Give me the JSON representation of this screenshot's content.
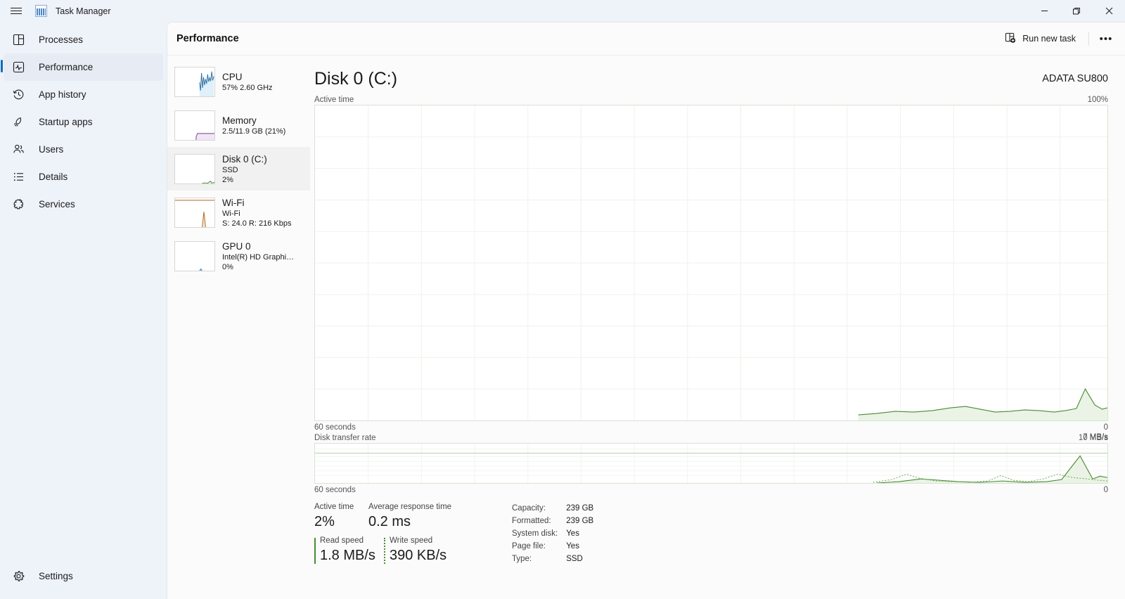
{
  "window": {
    "app_title": "Task Manager",
    "app_icon": "task-manager-icon",
    "menu_icon": "hamburger-icon",
    "minimize": "minimize-icon",
    "maximize": "maximize-icon",
    "close": "close-icon"
  },
  "sidebar": {
    "items": [
      {
        "label": "Processes",
        "icon": "processes-icon",
        "active": false
      },
      {
        "label": "Performance",
        "icon": "performance-icon",
        "active": true
      },
      {
        "label": "App history",
        "icon": "history-icon",
        "active": false
      },
      {
        "label": "Startup apps",
        "icon": "rocket-icon",
        "active": false
      },
      {
        "label": "Users",
        "icon": "users-icon",
        "active": false
      },
      {
        "label": "Details",
        "icon": "list-icon",
        "active": false
      },
      {
        "label": "Services",
        "icon": "services-icon",
        "active": false
      }
    ],
    "settings": {
      "label": "Settings",
      "icon": "gear-icon"
    }
  },
  "header": {
    "title": "Performance",
    "run_new_task": "Run new task",
    "run_new_task_icon": "new-task-icon",
    "more_options": "•••"
  },
  "devices": [
    {
      "name": "CPU",
      "lines": [
        "57%  2.60 GHz"
      ],
      "selected": false,
      "color": "#2e6fa3"
    },
    {
      "name": "Memory",
      "lines": [
        "2.5/11.9 GB (21%)"
      ],
      "selected": false,
      "color": "#7a3d92"
    },
    {
      "name": "Disk 0 (C:)",
      "lines": [
        "SSD",
        "2%"
      ],
      "selected": true,
      "color": "#4a8a35"
    },
    {
      "name": "Wi-Fi",
      "lines": [
        "Wi-Fi",
        "S: 24.0 R: 216 Kbps"
      ],
      "selected": false,
      "color": "#b5651d"
    },
    {
      "name": "GPU 0",
      "lines": [
        "Intel(R) HD Graphi…",
        "0%"
      ],
      "selected": false,
      "color": "#2e6fa3"
    }
  ],
  "detail": {
    "title": "Disk 0 (C:)",
    "model": "ADATA SU800",
    "active_time_label": "Active time",
    "active_time_max": "100%",
    "active_time_min": "0",
    "duration_top": "60 seconds",
    "duration_bottom": "60 seconds",
    "transfer_label": "Disk transfer rate",
    "transfer_max": "10 MB/s",
    "transfer_threshold": "7 MB/s",
    "transfer_min": "0"
  },
  "stats": {
    "active_time": {
      "label": "Active time",
      "value": "2%"
    },
    "average_response_time": {
      "label": "Average response time",
      "value": "0.2 ms"
    },
    "read_speed": {
      "label": "Read speed",
      "value": "1.8 MB/s"
    },
    "write_speed": {
      "label": "Write speed",
      "value": "390 KB/s"
    },
    "specs": [
      {
        "key": "Capacity:",
        "value": "239 GB"
      },
      {
        "key": "Formatted:",
        "value": "239 GB"
      },
      {
        "key": "System disk:",
        "value": "Yes"
      },
      {
        "key": "Page file:",
        "value": "Yes"
      },
      {
        "key": "Type:",
        "value": "SSD"
      }
    ]
  },
  "colors": {
    "accent": "#0f6cbd",
    "disk_line": "#4a8a35",
    "disk_fill": "#eaf3e5",
    "grid": "#eef3ec",
    "plot_border": "#d7e4d2"
  },
  "chart_data": [
    {
      "type": "area",
      "title": "Active time",
      "ylabel": "Active time (%)",
      "xlabel": "60 seconds",
      "ylim": [
        0,
        100
      ],
      "grid": true,
      "series": [
        {
          "name": "Active time",
          "values": [
            0,
            0,
            0,
            0,
            0,
            0,
            0,
            0,
            0,
            0,
            0,
            0,
            0,
            0,
            0,
            0,
            0,
            0,
            0,
            0,
            0,
            0,
            0,
            0,
            0,
            0,
            0,
            0,
            0,
            0,
            0,
            0,
            0,
            0,
            0,
            0,
            0,
            0,
            0,
            0,
            0,
            0,
            0,
            0,
            2,
            3,
            3,
            3,
            4,
            5,
            6,
            5,
            3,
            2,
            2,
            3,
            2,
            2,
            3,
            3,
            2,
            2,
            3,
            4,
            3,
            2,
            3,
            9,
            5,
            2
          ]
        }
      ]
    },
    {
      "type": "line",
      "title": "Disk transfer rate",
      "ylabel": "MB/s",
      "xlabel": "60 seconds",
      "ylim": [
        0,
        10
      ],
      "threshold": 7,
      "grid": true,
      "series": [
        {
          "name": "Read speed",
          "style": "solid",
          "values": [
            0,
            0,
            0,
            0,
            0,
            0,
            0,
            0,
            0,
            0,
            0,
            0,
            0,
            0,
            0,
            0,
            0,
            0,
            0,
            0,
            0,
            0,
            0,
            0,
            0,
            0,
            0,
            0,
            0,
            0,
            0,
            0,
            0,
            0,
            0,
            0,
            0,
            0,
            0,
            0,
            0,
            0,
            0.1,
            0.2,
            0.3,
            0.5,
            0.8,
            1.0,
            0.8,
            0.5,
            0.3,
            0.2,
            0.2,
            0.3,
            0.4,
            0.5,
            0.6,
            0.5,
            0.4,
            0.6,
            1.0,
            3.0,
            5.8,
            2.5,
            0.8,
            1.5,
            1.8,
            2.0,
            1.2,
            0.6
          ]
        },
        {
          "name": "Write speed",
          "style": "dotted",
          "values": [
            0,
            0,
            0,
            0,
            0,
            0,
            0,
            0,
            0,
            0,
            0,
            0,
            0,
            0,
            0,
            0,
            0,
            0,
            0,
            0,
            0,
            0,
            0,
            0,
            0,
            0,
            0,
            0,
            0,
            0,
            0,
            0,
            0,
            0,
            0,
            0,
            0,
            0,
            0,
            0,
            0.2,
            0.6,
            1.4,
            2.2,
            1.6,
            0.9,
            0.5,
            0.3,
            0.3,
            0.4,
            0.4,
            0.3,
            0.3,
            0.4,
            0.5,
            0.4,
            0.3,
            0.4,
            1.8,
            1.0,
            0.5,
            1.4,
            2.2,
            1.5,
            1.0,
            1.2,
            1.0,
            0.9,
            0.6,
            0.4
          ]
        }
      ]
    }
  ]
}
